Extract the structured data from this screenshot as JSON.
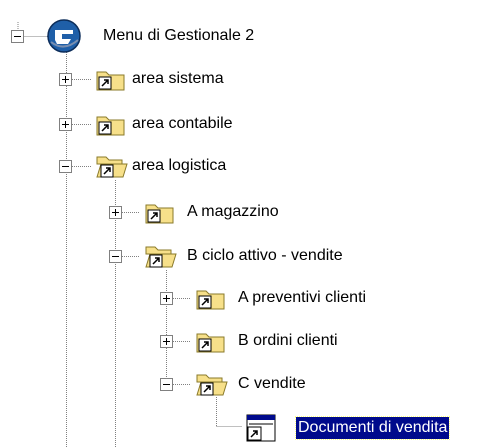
{
  "tree": {
    "root": {
      "label": "Menu di Gestionale 2",
      "expanded": true,
      "icon": "gestionale-logo-icon"
    },
    "nodes": [
      {
        "label": "area sistema",
        "expanded": false,
        "icon": "folder-shortcut-icon"
      },
      {
        "label": "area contabile",
        "expanded": false,
        "icon": "folder-shortcut-icon"
      },
      {
        "label": "area logistica",
        "expanded": true,
        "icon": "folder-open-shortcut-icon"
      },
      {
        "label": "A magazzino",
        "expanded": false,
        "icon": "folder-shortcut-icon"
      },
      {
        "label": "B ciclo attivo - vendite",
        "expanded": true,
        "icon": "folder-open-shortcut-icon"
      },
      {
        "label": "A preventivi clienti",
        "expanded": false,
        "icon": "folder-shortcut-icon"
      },
      {
        "label": "B ordini clienti",
        "expanded": false,
        "icon": "folder-shortcut-icon"
      },
      {
        "label": "C vendite",
        "expanded": true,
        "icon": "folder-open-shortcut-icon"
      },
      {
        "label": "Documenti di vendita",
        "selected": true,
        "icon": "window-shortcut-icon"
      }
    ]
  },
  "colors": {
    "selection_bg": "#000a8c",
    "selection_text": "#ffffff",
    "folder": "#f7e08a",
    "folder_dark": "#8a7a2a",
    "logo_blue": "#1f5fa8"
  }
}
